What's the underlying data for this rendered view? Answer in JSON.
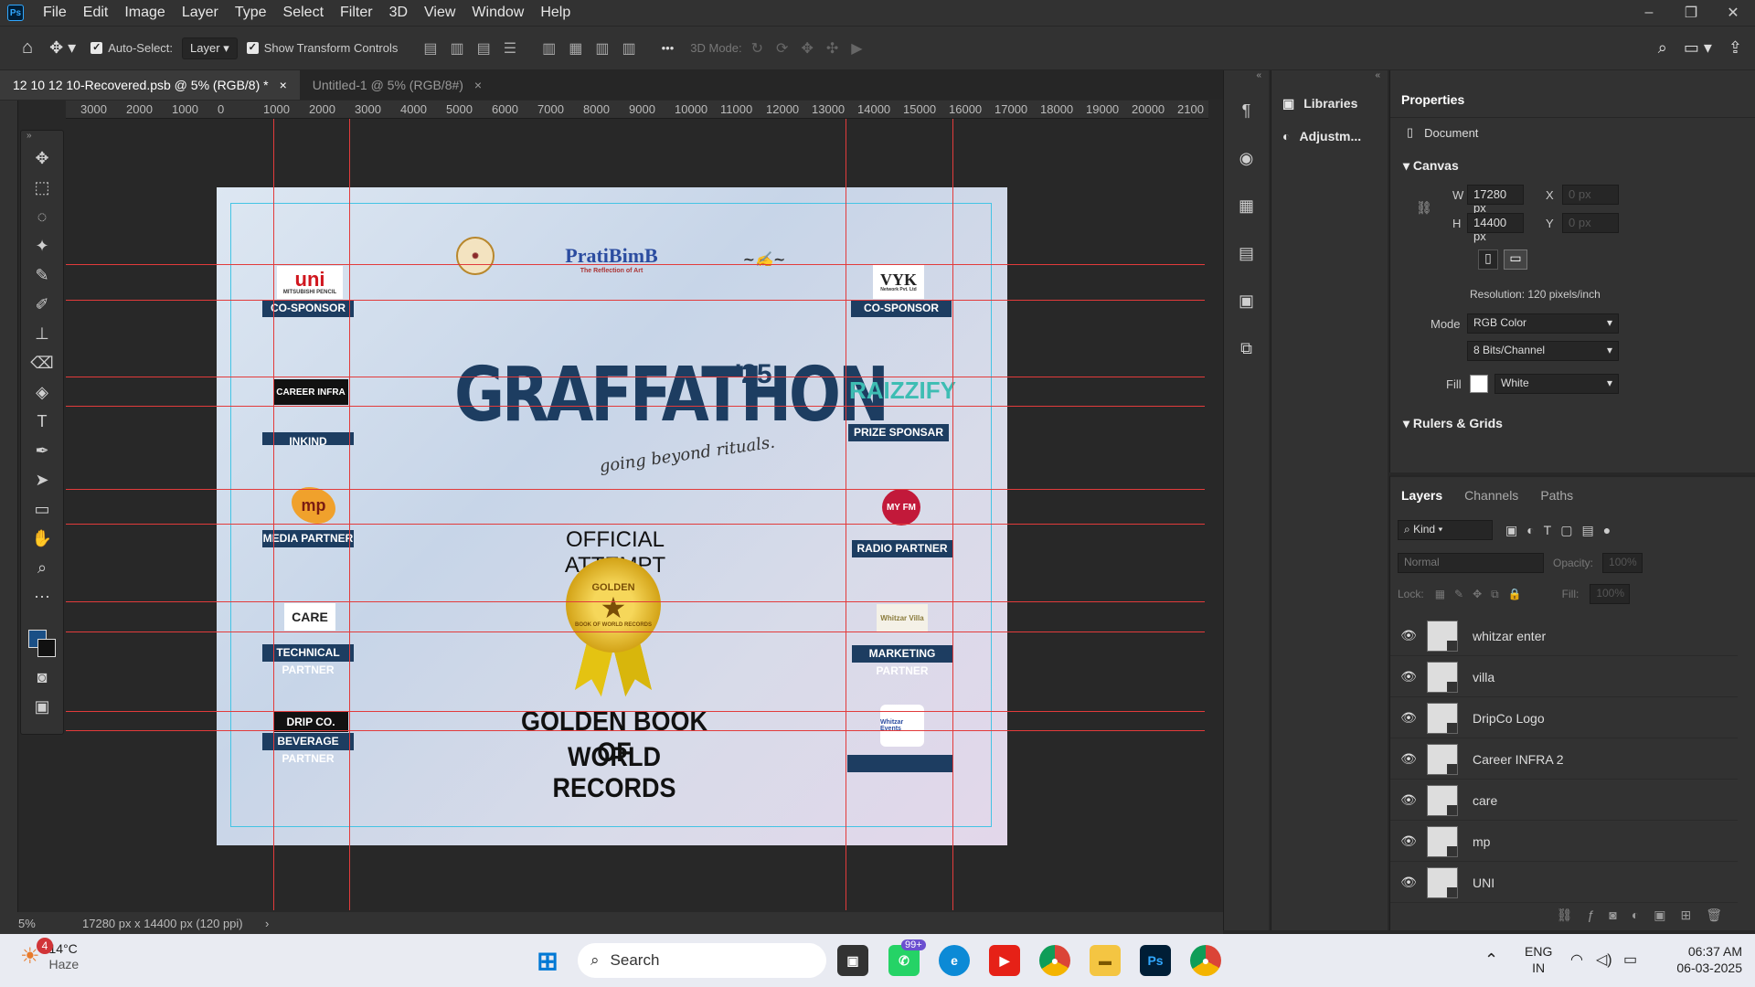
{
  "menubar": {
    "logo": "Ps",
    "items": [
      "File",
      "Edit",
      "Image",
      "Layer",
      "Type",
      "Select",
      "Filter",
      "3D",
      "View",
      "Window",
      "Help"
    ],
    "win_controls": [
      "–",
      "❐",
      "✕"
    ]
  },
  "options": {
    "auto_select": "Auto-Select:",
    "auto_select_value": "Layer",
    "show_transform": "Show Transform Controls",
    "mode_3d": "3D Mode:",
    "more": "•••"
  },
  "tabs": [
    {
      "label": "12 10 12 10-Recovered.psb @ 5% (RGB/8) *",
      "close": "×"
    },
    {
      "label": "Untitled-1 @ 5% (RGB/8#)",
      "close": "×"
    }
  ],
  "ruler": {
    "top_labels": [
      "3000",
      "2000",
      "1000",
      "0",
      "1000",
      "2000",
      "3000",
      "4000",
      "5000",
      "6000",
      "7000",
      "8000",
      "9000",
      "10000",
      "11000",
      "12000",
      "13000",
      "14000",
      "15000",
      "16000",
      "17000",
      "18000",
      "19000",
      "20000",
      "2100"
    ]
  },
  "canvas": {
    "title": "GRAFFATHON",
    "title_sup": "'25",
    "tagline": "going beyond rituals.",
    "official": "OFFICIAL ATTEMPT",
    "record_line1": "GOLDEN BOOK OF",
    "record_line2": "WORLD RECORDS",
    "seal_text": "GOLDEN",
    "medal_text": "BOOK OF WORLD RECORDS",
    "brand_top": "PratiBimB",
    "brand_top_sub": "The Reflection of Art",
    "left": [
      {
        "logo": "uni",
        "sub": "MITSUBISHI PENCIL",
        "label": "CO-SPONSOR"
      },
      {
        "logo": "CAREER INFRA",
        "label": "INKIND SPONSORS"
      },
      {
        "logo": "mp",
        "label": "MEDIA PARTNER"
      },
      {
        "logo": "CARE",
        "label": "TECHNICAL PARTNER"
      },
      {
        "logo": "DRIP CO.",
        "label": "BEVERAGE PARTNER"
      }
    ],
    "right": [
      {
        "logo": "VYK",
        "sub": "Network Pvt. Ltd",
        "label": "CO-SPONSOR"
      },
      {
        "logo": "RAIZZIFY",
        "label": "PRIZE SPONSAR"
      },
      {
        "logo": "MY FM",
        "label": "RADIO PARTNER"
      },
      {
        "logo": "Whitzar Villa",
        "label": "MARKETING PARTNER"
      },
      {
        "logo": "Whitzar Events",
        "label": ""
      }
    ]
  },
  "status": {
    "zoom": "5%",
    "doc": "17280 px x 14400 px (120 ppi)",
    "arrow": "›"
  },
  "panels": {
    "libraries": "Libraries",
    "adjustments": "Adjustm..."
  },
  "properties": {
    "title": "Properties",
    "doc": "Document",
    "canvas": "Canvas",
    "w_label": "W",
    "w": "17280 px",
    "h_label": "H",
    "h": "14400 px",
    "x_label": "X",
    "x": "0 px",
    "y_label": "Y",
    "y": "0 px",
    "resolution": "Resolution: 120 pixels/inch",
    "mode_label": "Mode",
    "mode": "RGB Color",
    "bits": "8 Bits/Channel",
    "fill_label": "Fill",
    "fill": "White",
    "rulers": "Rulers & Grids"
  },
  "layers_panel": {
    "tabs": [
      "Layers",
      "Channels",
      "Paths"
    ],
    "kind": "Kind",
    "blend": "Normal",
    "opacity_label": "Opacity:",
    "opacity": "100%",
    "lock_label": "Lock:",
    "fill_label": "Fill:",
    "fill": "100%",
    "layers": [
      "whitzar enter",
      "villa",
      "DripCo Logo",
      "Career INFRA 2",
      "care",
      "mp",
      "UNI"
    ]
  },
  "taskbar": {
    "weather_temp": "14°C",
    "weather_desc": "Haze",
    "weather_badge": "4",
    "search": "Search",
    "wa_badge": "99+",
    "lang1": "ENG",
    "lang2": "IN",
    "time": "06:37 AM",
    "date": "06-03-2025"
  },
  "colors": {
    "accent": "#31a8ff",
    "guide": "#e23b3b",
    "label_bg": "#1d3d61",
    "title": "#1d3d61",
    "fg_color": "#1a4f86"
  }
}
